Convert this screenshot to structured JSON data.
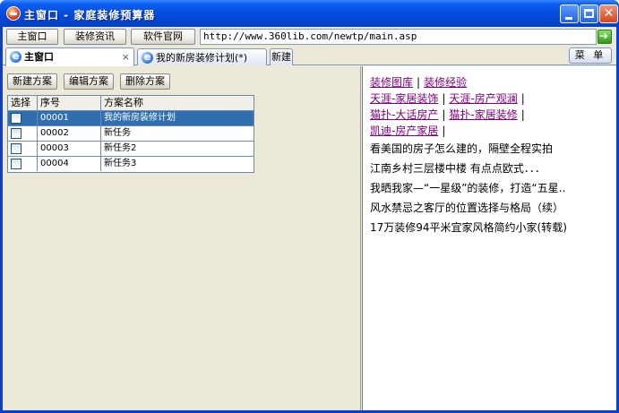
{
  "window": {
    "title": "主窗口 - 家庭装修预算器"
  },
  "toolbar": {
    "home_label": "主窗口",
    "info_label": "装修资讯",
    "site_label": "软件官网",
    "url": "http://www.360lib.com/newtp/main.asp"
  },
  "tabs": [
    {
      "label": "主窗口",
      "close": "×"
    },
    {
      "label": "我的新房装修计划(*)"
    },
    {
      "label": "新建"
    }
  ],
  "menu_label": "菜 单",
  "actions": {
    "new_label": "新建方案",
    "edit_label": "编辑方案",
    "delete_label": "删除方案"
  },
  "grid": {
    "columns": [
      "选择",
      "序号",
      "方案名称"
    ],
    "rows": [
      {
        "no": "00001",
        "name": "我的新房装修计划"
      },
      {
        "no": "00002",
        "name": "新任务"
      },
      {
        "no": "00003",
        "name": "新任务2"
      },
      {
        "no": "00004",
        "name": "新任务3"
      }
    ]
  },
  "links": {
    "row1": [
      "装修图库",
      "装修经验"
    ],
    "row2": [
      "天涯-家居装饰",
      "天涯-房产观澜"
    ],
    "row3": [
      "猫扑-大话房产",
      "猫扑-家居装修"
    ],
    "row4": [
      "凯迪-房产家居"
    ],
    "separator": "|"
  },
  "articles": [
    "看美国的房子怎么建的，隔壁全程实拍",
    "江南乡村三层楼中楼 有点点欧式．．．",
    "我晒我家—“一星级”的装修，打造“五星..",
    "风水禁忌之客厅的位置选择与格局（续）",
    "17万装修94平米宜家风格简约小家(转载)"
  ]
}
